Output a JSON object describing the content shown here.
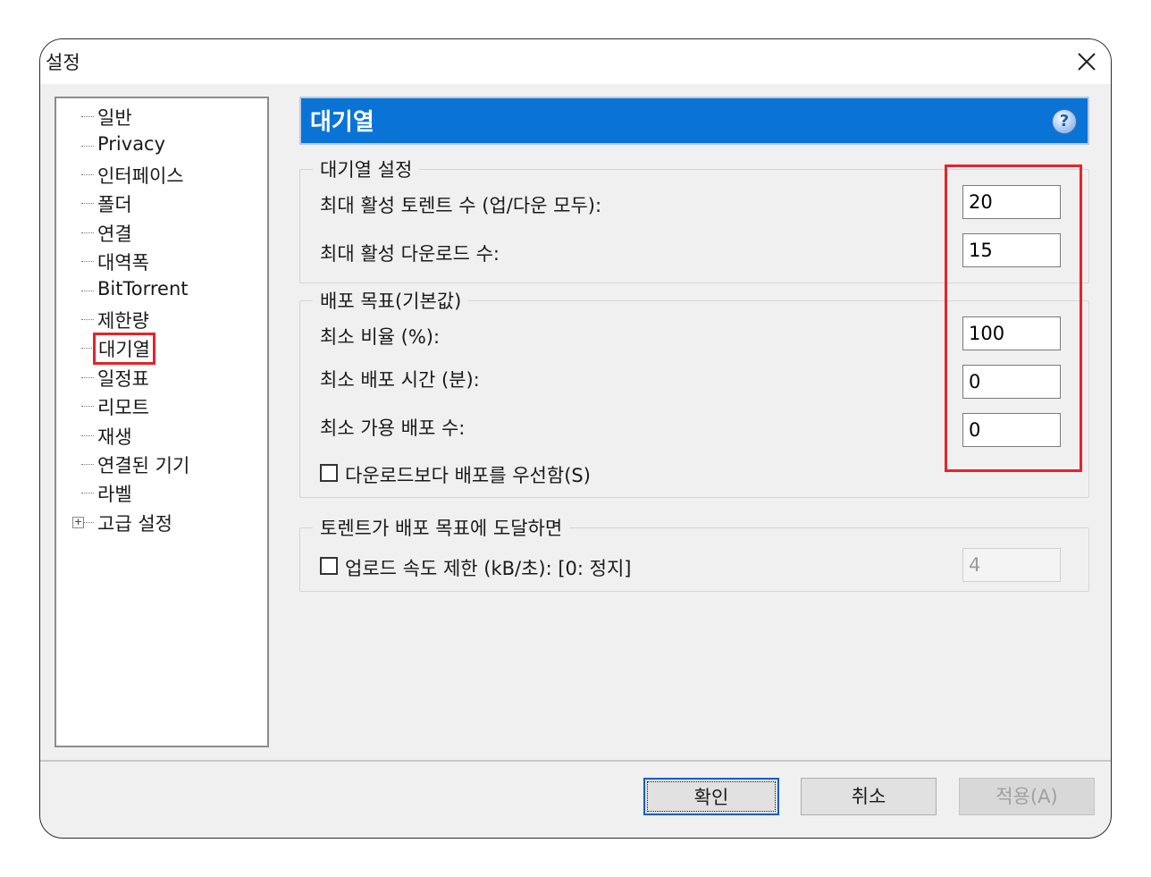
{
  "window": {
    "title": "설정"
  },
  "tree": {
    "items": [
      {
        "label": "일반"
      },
      {
        "label": "Privacy"
      },
      {
        "label": "인터페이스"
      },
      {
        "label": "폴더"
      },
      {
        "label": "연결"
      },
      {
        "label": "대역폭"
      },
      {
        "label": "BitTorrent"
      },
      {
        "label": "제한량"
      },
      {
        "label": "대기열",
        "selected": true
      },
      {
        "label": "일정표"
      },
      {
        "label": "리모트"
      },
      {
        "label": "재생"
      },
      {
        "label": "연결된 기기"
      },
      {
        "label": "라벨"
      },
      {
        "label": "고급 설정",
        "expander": "+"
      }
    ]
  },
  "header": {
    "title": "대기열",
    "help_icon": "?"
  },
  "queue_settings": {
    "legend": "대기열 설정",
    "max_active_torrents_label": "최대 활성 토렌트 수 (업/다운 모두):",
    "max_active_torrents_value": "20",
    "max_active_downloads_label": "최대 활성 다운로드 수:",
    "max_active_downloads_value": "15"
  },
  "seeding_goal": {
    "legend": "배포 목표(기본값)",
    "min_ratio_label": "최소 비율 (%):",
    "min_ratio_value": "100",
    "min_seed_time_label": "최소 배포 시간 (분):",
    "min_seed_time_value": "0",
    "min_available_seeds_label": "최소 가용 배포 수:",
    "min_available_seeds_value": "0",
    "prioritize_seeding_label": "다운로드보다 배포를 우선함(S)"
  },
  "on_goal_reached": {
    "legend": "토렌트가 배포 목표에 도달하면",
    "limit_upload_label": "업로드 속도 제한 (kB/초): [0: 정지]",
    "limit_upload_value": "4"
  },
  "buttons": {
    "ok": "확인",
    "cancel": "취소",
    "apply": "적용(A)"
  }
}
